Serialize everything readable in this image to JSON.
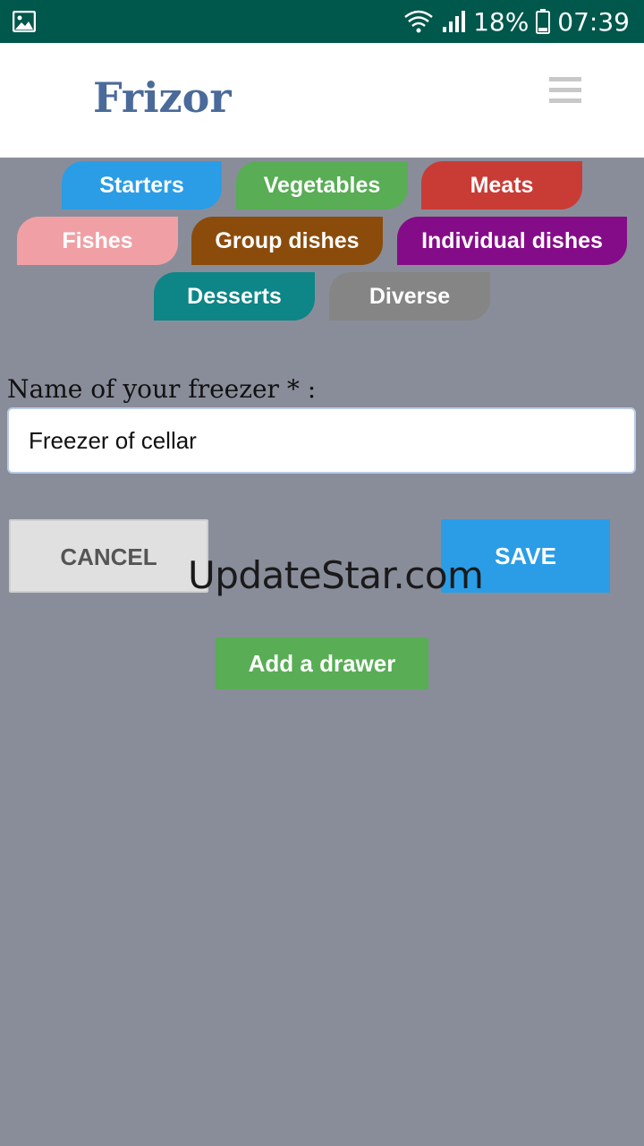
{
  "status_bar": {
    "battery": "18%",
    "time": "07:39",
    "icons": [
      "gallery-icon",
      "wifi-icon",
      "signal-icon",
      "battery-icon"
    ]
  },
  "header": {
    "title": "Frizor",
    "menu_icon": "hamburger-menu-icon"
  },
  "categories": [
    {
      "label": "Starters",
      "color": "#2a9de6"
    },
    {
      "label": "Vegetables",
      "color": "#58ad55"
    },
    {
      "label": "Meats",
      "color": "#c93c36"
    },
    {
      "label": "Fishes",
      "color": "#f0a0a4"
    },
    {
      "label": "Group dishes",
      "color": "#8b4c0b"
    },
    {
      "label": "Individual dishes",
      "color": "#850c88"
    },
    {
      "label": "Desserts",
      "color": "#0e8586"
    },
    {
      "label": "Diverse",
      "color": "#858585"
    }
  ],
  "form": {
    "freezer_label": "Name of your freezer * :",
    "freezer_value": "Freezer of cellar",
    "cancel_label": "CANCEL",
    "save_label": "SAVE",
    "add_drawer_label": "Add a drawer"
  },
  "watermark": "UpdateStar.com",
  "colors": {
    "status_bar": "#00574b",
    "background": "#898d9a",
    "title": "#4a6a9a",
    "save": "#2a9de6",
    "add_drawer": "#58ad55"
  }
}
